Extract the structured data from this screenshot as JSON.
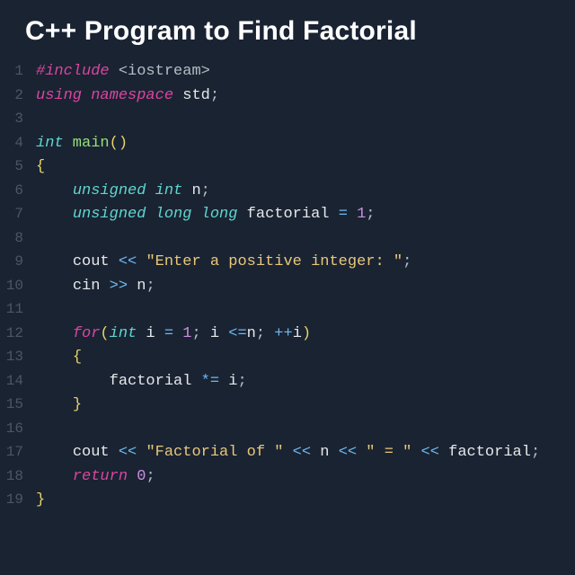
{
  "title": "C++ Program to Find Factorial",
  "lines": {
    "n1": "1",
    "n2": "2",
    "n3": "3",
    "n4": "4",
    "n5": "5",
    "n6": "6",
    "n7": "7",
    "n8": "8",
    "n9": "9",
    "n10": "10",
    "n11": "11",
    "n12": "12",
    "n13": "13",
    "n14": "14",
    "n15": "15",
    "n16": "16",
    "n17": "17",
    "n18": "18",
    "n19": "19"
  },
  "code": {
    "l1_include": "#include",
    "l1_header": " <iostream>",
    "l2_using": "using",
    "l2_namespace": " namespace",
    "l2_std": " std",
    "l2_semi": ";",
    "l4_int": "int",
    "l4_main": " main",
    "l4_lp": "(",
    "l4_rp": ")",
    "l5_lb": "{",
    "l6_ind": "    ",
    "l6_unsigned": "unsigned",
    "l6_int": " int",
    "l6_n": " n",
    "l6_semi": ";",
    "l7_ind": "    ",
    "l7_unsigned": "unsigned",
    "l7_long1": " long",
    "l7_long2": " long",
    "l7_fact": " factorial ",
    "l7_eq": "=",
    "l7_sp": " ",
    "l7_one": "1",
    "l7_semi": ";",
    "l9_ind": "    ",
    "l9_cout": "cout ",
    "l9_op": "<<",
    "l9_sp": " ",
    "l9_str": "\"Enter a positive integer: \"",
    "l9_semi": ";",
    "l10_ind": "    ",
    "l10_cin": "cin ",
    "l10_op": ">>",
    "l10_sp": " ",
    "l10_n": "n",
    "l10_semi": ";",
    "l12_ind": "    ",
    "l12_for": "for",
    "l12_lp": "(",
    "l12_int": "int",
    "l12_i": " i ",
    "l12_eq": "=",
    "l12_sp1": " ",
    "l12_one": "1",
    "l12_semi1": ";",
    "l12_i2": " i ",
    "l12_le": "<=",
    "l12_n": "n",
    "l12_semi2": ";",
    "l12_sp2": " ",
    "l12_pp": "++",
    "l12_i3": "i",
    "l12_rp": ")",
    "l13_ind": "    ",
    "l13_lb": "{",
    "l14_ind": "        ",
    "l14_fact": "factorial ",
    "l14_op": "*=",
    "l14_sp": " ",
    "l14_i": "i",
    "l14_semi": ";",
    "l15_ind": "    ",
    "l15_rb": "}",
    "l17_ind": "    ",
    "l17_cout": "cout ",
    "l17_op1": "<<",
    "l17_sp1": " ",
    "l17_str1": "\"Factorial of \"",
    "l17_sp2": " ",
    "l17_op2": "<<",
    "l17_sp3": " ",
    "l17_n": "n",
    "l17_sp4": " ",
    "l17_op3": "<<",
    "l17_sp5": " ",
    "l17_str2": "\" = \"",
    "l17_sp6": " ",
    "l17_op4": "<<",
    "l17_sp7": " ",
    "l17_fact": "factorial",
    "l17_semi": ";",
    "l18_ind": "    ",
    "l18_return": "return",
    "l18_sp": " ",
    "l18_zero": "0",
    "l18_semi": ";",
    "l19_rb": "}"
  }
}
